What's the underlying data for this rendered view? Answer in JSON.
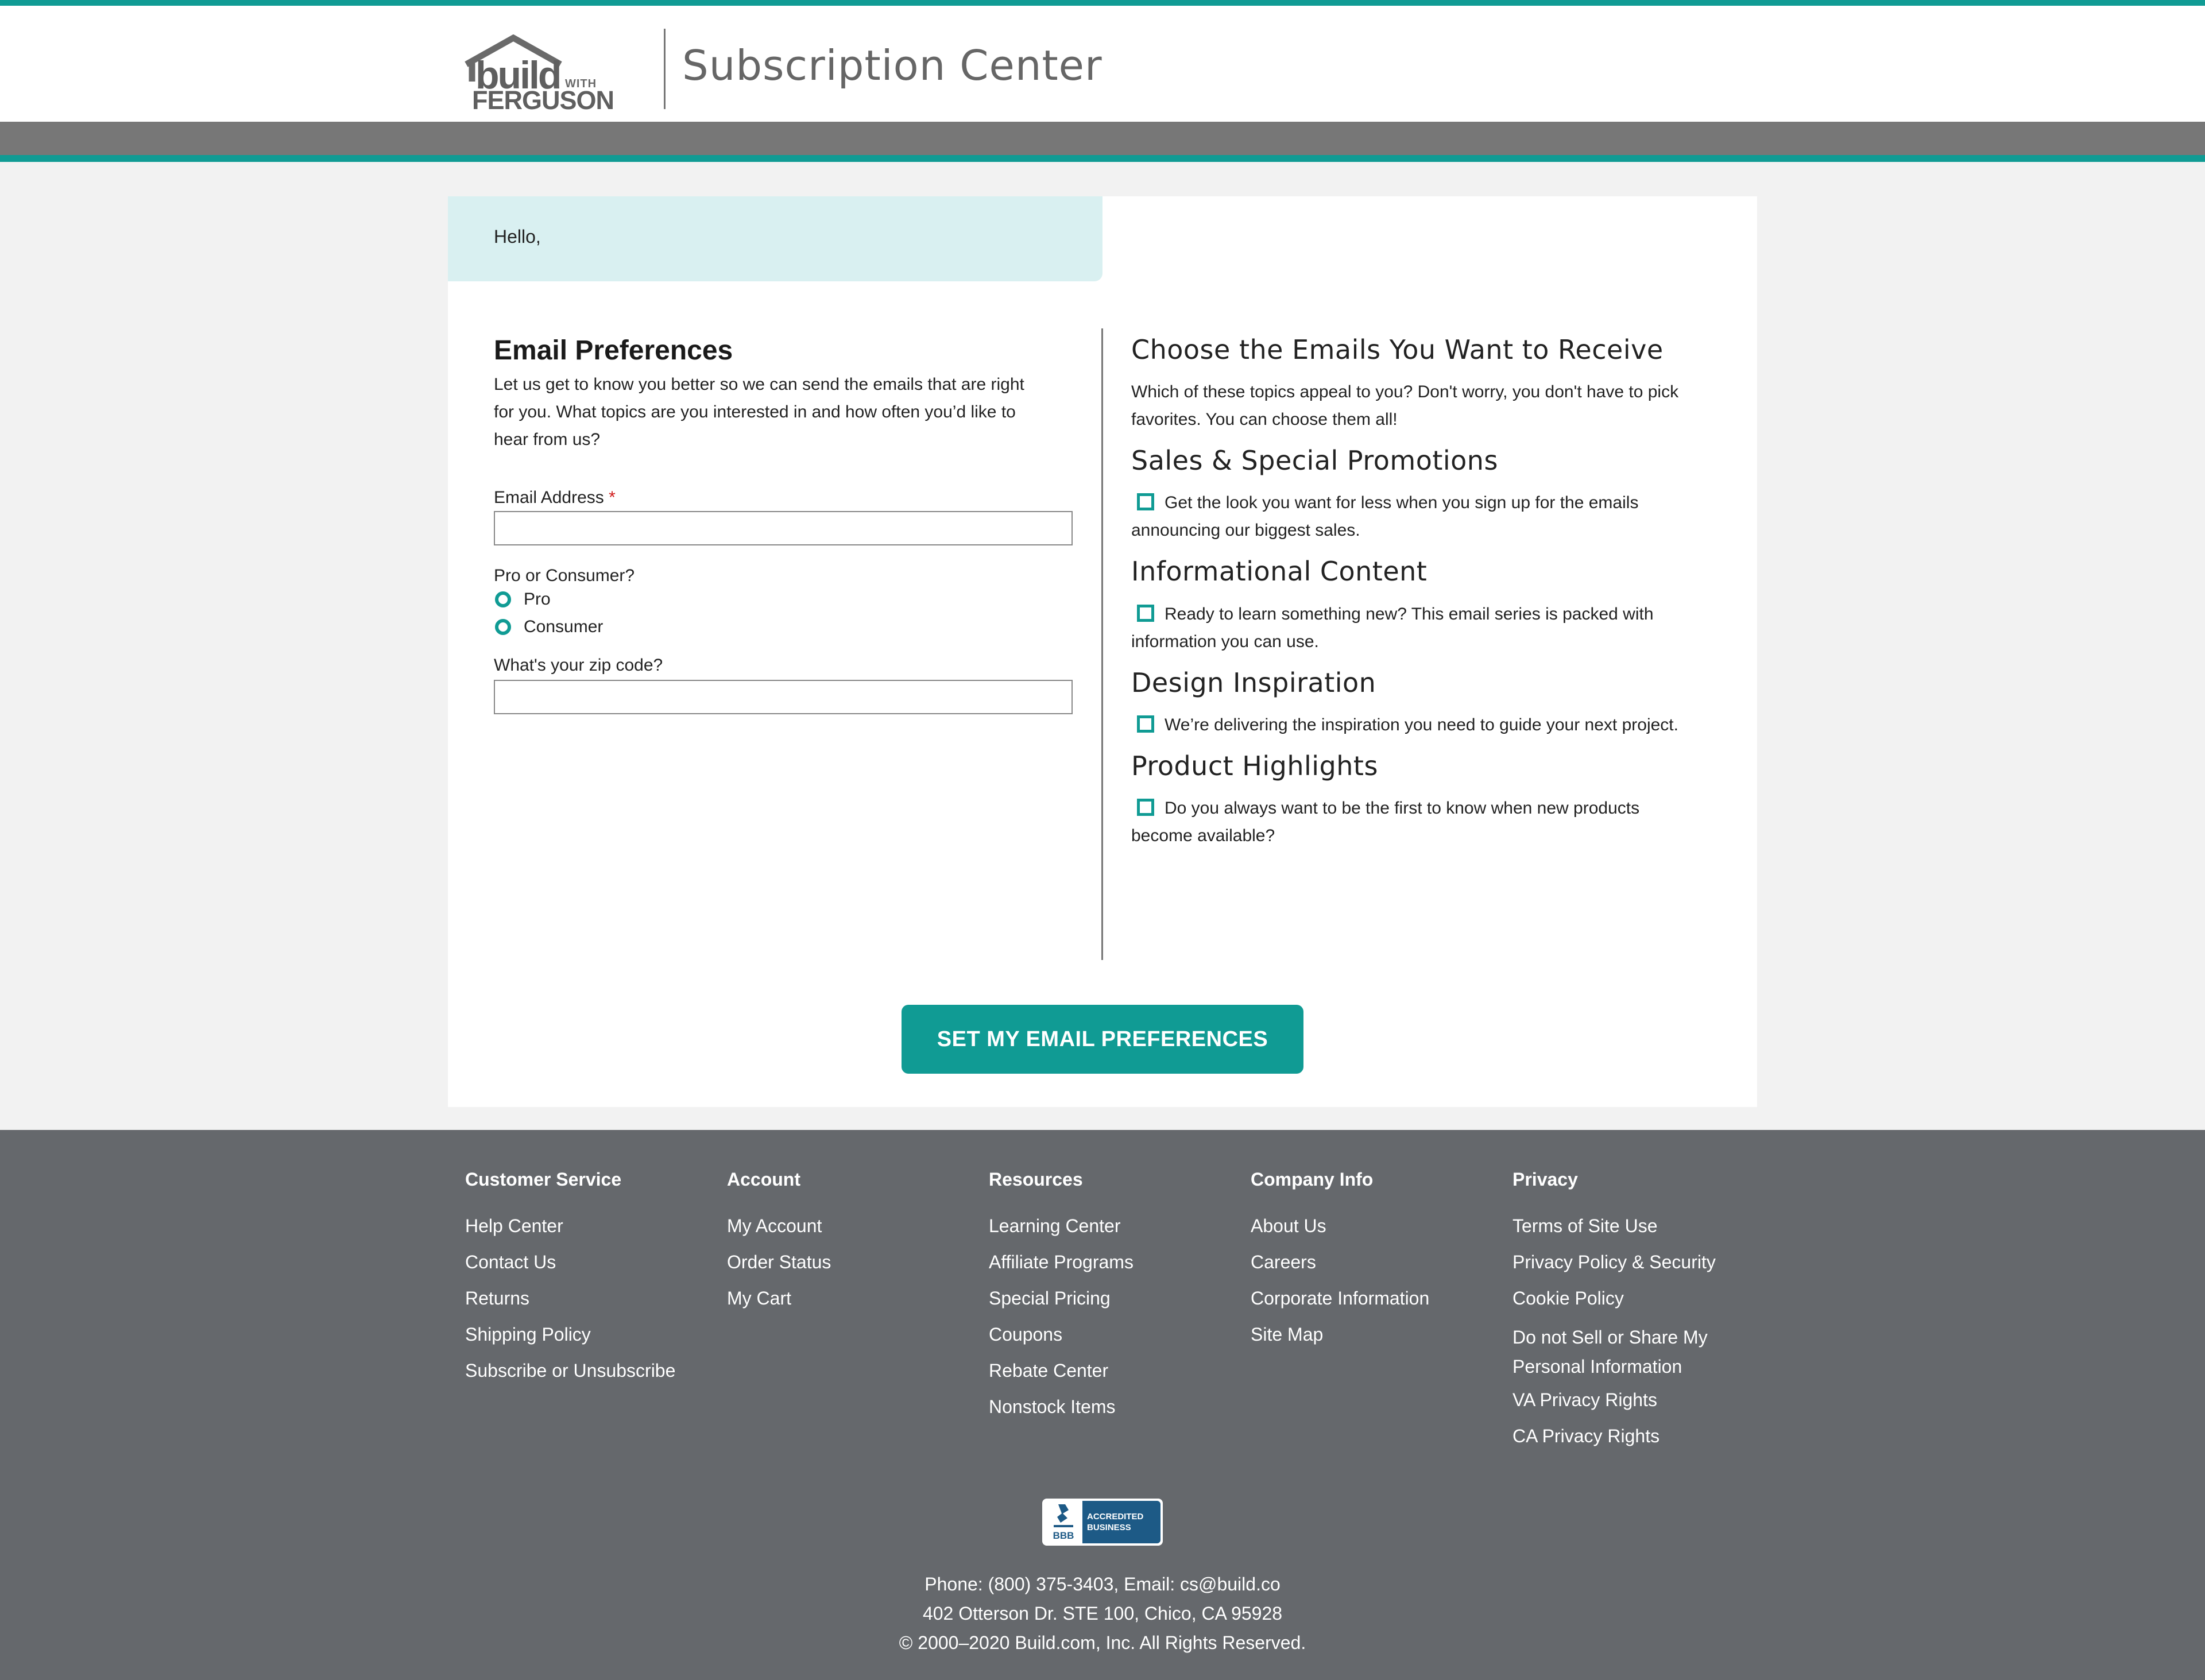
{
  "header": {
    "logo_word_build": "build",
    "logo_word_with": "WITH",
    "logo_word_ferguson": "FERGUSON",
    "title": "Subscription Center"
  },
  "colors": {
    "accent": "#109b94",
    "header_band": "#777777",
    "greeting_bg": "#d9f0f1",
    "footer_bg": "#65686c",
    "required": "#d01c1c"
  },
  "greeting": "Hello,",
  "preferences": {
    "title": "Email Preferences",
    "intro_lines": [
      "Let us get to know you better so we can send the emails that are right",
      "for you. What topics are you interested in and how often you’d like to",
      "hear from us?"
    ],
    "email_label": "Email Address",
    "required_marker": "*",
    "email_value": "",
    "pro_consumer_label": "Pro or Consumer?",
    "radio_options": [
      "Pro",
      "Consumer"
    ],
    "zip_label": "What's your zip code?",
    "zip_value": ""
  },
  "topics": {
    "heading": "Choose the Emails You Want to Receive",
    "intro_lines": [
      "Which of these topics appeal to you? Don't worry, you don't have to pick",
      "favorites. You can choose them all!"
    ],
    "items": [
      {
        "title": "Sales & Special Promotions",
        "lines": [
          "Get the look you want for less when you sign up for the emails",
          "announcing our biggest sales."
        ],
        "checked": false
      },
      {
        "title": "Informational Content",
        "lines": [
          "Ready to learn something new? This email series is packed with",
          "information you can use."
        ],
        "checked": false
      },
      {
        "title": "Design Inspiration",
        "lines": [
          "We’re delivering the inspiration you need to guide your next project."
        ],
        "checked": false
      },
      {
        "title": "Product Highlights",
        "lines": [
          "Do you always want to be the first to know when new products",
          "become available?"
        ],
        "checked": false
      }
    ]
  },
  "submit_label": "SET MY EMAIL PREFERENCES",
  "footer": {
    "columns": [
      {
        "heading": "Customer Service",
        "links": [
          "Help Center",
          "Contact Us",
          "Returns",
          "Shipping Policy",
          "Subscribe or Unsubscribe"
        ]
      },
      {
        "heading": "Account",
        "links": [
          "My Account",
          "Order Status",
          "My Cart"
        ]
      },
      {
        "heading": "Resources",
        "links": [
          "Learning Center",
          "Affiliate Programs",
          "Special Pricing",
          "Coupons",
          "Rebate Center",
          "Nonstock Items"
        ]
      },
      {
        "heading": "Company Info",
        "links": [
          "About Us",
          "Careers",
          "Corporate Information",
          "Site Map"
        ]
      },
      {
        "heading": "Privacy",
        "links": [
          "Terms of Site Use",
          "Privacy Policy & Security",
          "Cookie Policy",
          "Do not Sell or Share My Personal Information",
          "VA Privacy Rights",
          "CA Privacy Rights"
        ]
      }
    ],
    "bbb": {
      "mark": "BBB",
      "line1": "ACCREDITED",
      "line2": "BUSINESS"
    },
    "phone_line": "Phone: (800) 375-3403, Email: cs@build.co",
    "address_line": "402 Otterson Dr. STE 100, Chico, CA 95928",
    "copyright_line": "© 2000–2020 Build.com, Inc. All Rights Reserved."
  }
}
